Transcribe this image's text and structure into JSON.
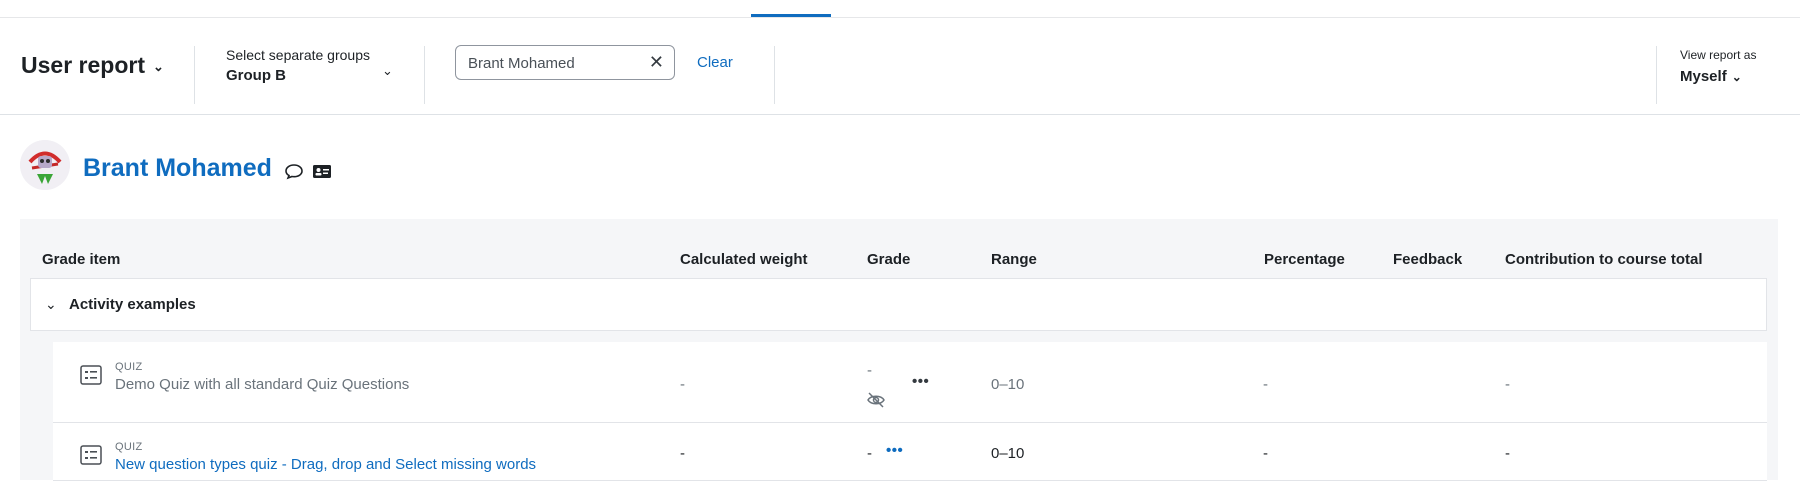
{
  "actionbar": {
    "report_selector": "User report",
    "groups_label": "Select separate groups",
    "groups_value": "Group B",
    "search_value": "Brant Mohamed",
    "clear_label": "Clear",
    "view_as_label": "View report as",
    "view_as_value": "Myself"
  },
  "user": {
    "name": "Brant Mohamed",
    "avatar_icon": "user-avatar",
    "message_icon": "speech-bubble-icon",
    "profile_icon": "id-card-icon"
  },
  "table": {
    "headers": [
      "Grade item",
      "Calculated weight",
      "Grade",
      "Range",
      "Percentage",
      "Feedback",
      "Contribution to course total"
    ],
    "category": "Activity examples",
    "rows": [
      {
        "type": "QUIZ",
        "name": "Demo Quiz with all standard Quiz Questions",
        "hidden": true,
        "weight": "-",
        "grade": "-",
        "range": "0–10",
        "percentage": "-",
        "feedback": "",
        "contribution": "-"
      },
      {
        "type": "QUIZ",
        "name": "New question types quiz - Drag, drop and Select missing words",
        "hidden": false,
        "weight": "-",
        "grade": "-",
        "range": "0–10",
        "percentage": "-",
        "feedback": "",
        "contribution": "-"
      }
    ]
  },
  "colors": {
    "link": "#0f6cbf",
    "dimmed": "#6a737b",
    "table_bg": "#f5f6f8"
  }
}
